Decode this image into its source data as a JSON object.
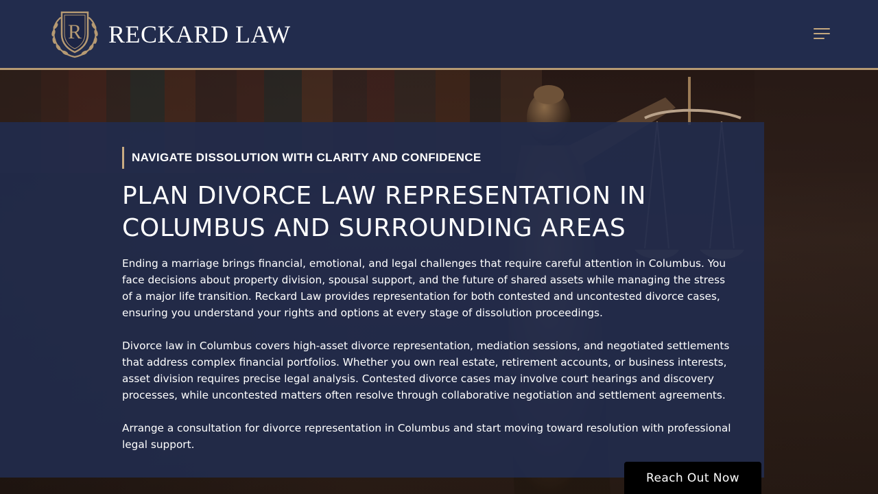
{
  "header": {
    "brand": "RECKARD LAW",
    "logo_letter": "R",
    "menu_icon": "hamburger-menu-icon"
  },
  "hero": {
    "eyebrow": "NAVIGATE DISSOLUTION WITH CLARITY AND CONFIDENCE",
    "title": "PLAN DIVORCE LAW REPRESENTATION IN COLUMBUS AND SURROUNDING AREAS",
    "paragraphs": [
      "Ending a marriage brings financial, emotional, and legal challenges that require careful attention in Columbus. You face decisions about property division, spousal support, and the future of shared assets while managing the stress of a major life transition. Reckard Law provides representation for both contested and uncontested divorce cases, ensuring you understand your rights and options at every stage of dissolution proceedings.",
      "Divorce law in Columbus covers high-asset divorce representation, mediation sessions, and negotiated settlements that address complex financial portfolios. Whether you own real estate, retirement accounts, or business interests, asset division requires precise legal analysis. Contested divorce cases may involve court hearings and discovery processes, while uncontested matters often resolve through collaborative negotiation and settlement agreements.",
      "Arrange a consultation for divorce representation in Columbus and start moving toward resolution with professional legal support."
    ]
  },
  "cta": {
    "label": "Reach Out Now"
  },
  "colors": {
    "navy": "#222c4d",
    "gold": "#b69a73",
    "panel": "#222b4c",
    "cta_bg": "#000000"
  }
}
